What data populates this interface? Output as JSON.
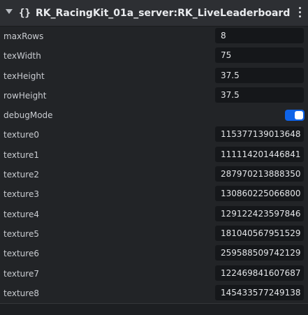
{
  "header": {
    "script_glyph": "{}",
    "title": "RK_RacingKit_01a_server:RK_LiveLeaderboard"
  },
  "properties": [
    {
      "label": "maxRows",
      "value": "8"
    },
    {
      "label": "texWidth",
      "value": "75"
    },
    {
      "label": "texHeight",
      "value": "37.5"
    },
    {
      "label": "rowHeight",
      "value": "37.5"
    },
    {
      "label": "debugMode",
      "value": true
    },
    {
      "label": "texture0",
      "value": "115377139013648"
    },
    {
      "label": "texture1",
      "value": "111114201446841"
    },
    {
      "label": "texture2",
      "value": "287970213888350"
    },
    {
      "label": "texture3",
      "value": "130860225066800"
    },
    {
      "label": "texture4",
      "value": "129122423597846"
    },
    {
      "label": "texture5",
      "value": "181040567951529"
    },
    {
      "label": "texture6",
      "value": "259588509742129"
    },
    {
      "label": "texture7",
      "value": "122469841607687"
    },
    {
      "label": "texture8",
      "value": "145433577249138"
    }
  ],
  "colors": {
    "toggle_on": "#0e63e8",
    "panel_bg": "#222427",
    "field_bg": "#15171a"
  }
}
